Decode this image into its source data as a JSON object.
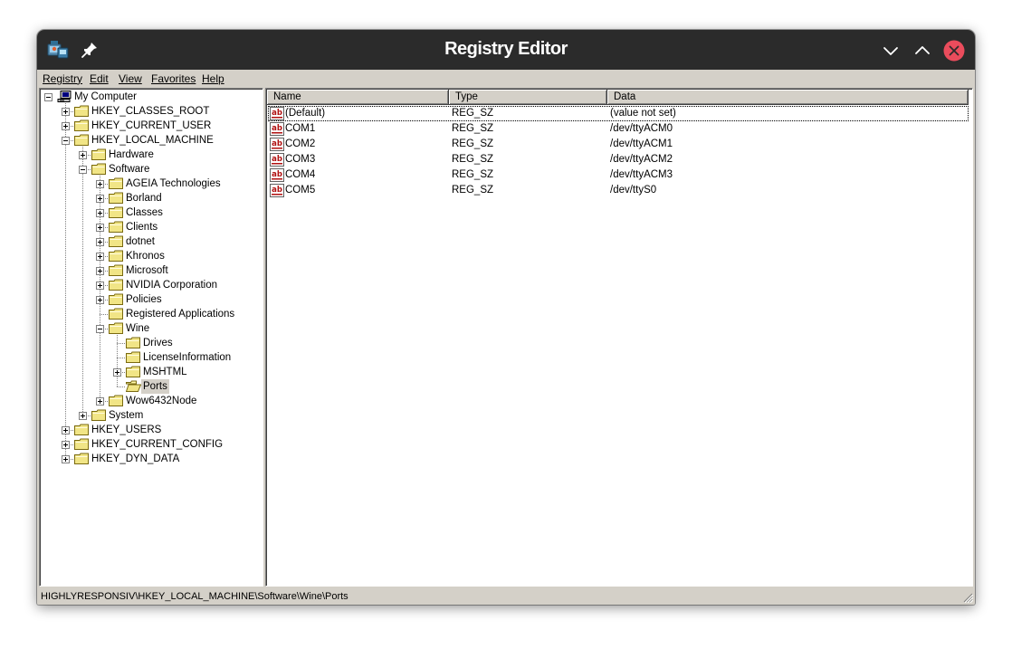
{
  "window": {
    "title": "Registry Editor"
  },
  "titlebar_icons": {
    "app": "registry-app-icon",
    "pin": "pin-icon",
    "minimize": "chevron-down-icon",
    "maximize": "chevron-up-icon",
    "close": "close-icon"
  },
  "menu": [
    "Registry",
    "Edit",
    "View",
    "Favorites",
    "Help"
  ],
  "tree": [
    {
      "label": "My Computer",
      "level": 0,
      "expander": "minus",
      "icon": "computer"
    },
    {
      "label": "HKEY_CLASSES_ROOT",
      "level": 1,
      "expander": "plus",
      "icon": "folder"
    },
    {
      "label": "HKEY_CURRENT_USER",
      "level": 1,
      "expander": "plus",
      "icon": "folder"
    },
    {
      "label": "HKEY_LOCAL_MACHINE",
      "level": 1,
      "expander": "minus",
      "icon": "folder"
    },
    {
      "label": "Hardware",
      "level": 2,
      "expander": "plus",
      "icon": "folder"
    },
    {
      "label": "Software",
      "level": 2,
      "expander": "minus",
      "icon": "folder"
    },
    {
      "label": "AGEIA Technologies",
      "level": 3,
      "expander": "plus",
      "icon": "folder"
    },
    {
      "label": "Borland",
      "level": 3,
      "expander": "plus",
      "icon": "folder"
    },
    {
      "label": "Classes",
      "level": 3,
      "expander": "plus",
      "icon": "folder"
    },
    {
      "label": "Clients",
      "level": 3,
      "expander": "plus",
      "icon": "folder"
    },
    {
      "label": "dotnet",
      "level": 3,
      "expander": "plus",
      "icon": "folder"
    },
    {
      "label": "Khronos",
      "level": 3,
      "expander": "plus",
      "icon": "folder"
    },
    {
      "label": "Microsoft",
      "level": 3,
      "expander": "plus",
      "icon": "folder"
    },
    {
      "label": "NVIDIA Corporation",
      "level": 3,
      "expander": "plus",
      "icon": "folder"
    },
    {
      "label": "Policies",
      "level": 3,
      "expander": "plus",
      "icon": "folder"
    },
    {
      "label": "Registered Applications",
      "level": 3,
      "expander": "none",
      "icon": "folder"
    },
    {
      "label": "Wine",
      "level": 3,
      "expander": "minus",
      "icon": "folder"
    },
    {
      "label": "Drives",
      "level": 4,
      "expander": "none",
      "icon": "folder"
    },
    {
      "label": "LicenseInformation",
      "level": 4,
      "expander": "none",
      "icon": "folder"
    },
    {
      "label": "MSHTML",
      "level": 4,
      "expander": "plus",
      "icon": "folder"
    },
    {
      "label": "Ports",
      "level": 4,
      "expander": "none",
      "icon": "folder-open",
      "selected": true
    },
    {
      "label": "Wow6432Node",
      "level": 3,
      "expander": "plus",
      "icon": "folder"
    },
    {
      "label": "System",
      "level": 2,
      "expander": "plus",
      "icon": "folder"
    },
    {
      "label": "HKEY_USERS",
      "level": 1,
      "expander": "plus",
      "icon": "folder"
    },
    {
      "label": "HKEY_CURRENT_CONFIG",
      "level": 1,
      "expander": "plus",
      "icon": "folder"
    },
    {
      "label": "HKEY_DYN_DATA",
      "level": 1,
      "expander": "plus",
      "icon": "folder"
    }
  ],
  "columns": [
    "Name",
    "Type",
    "Data"
  ],
  "values": [
    {
      "name": "(Default)",
      "type": "REG_SZ",
      "data": "(value not set)",
      "focused": true
    },
    {
      "name": "COM1",
      "type": "REG_SZ",
      "data": "/dev/ttyACM0"
    },
    {
      "name": "COM2",
      "type": "REG_SZ",
      "data": "/dev/ttyACM1"
    },
    {
      "name": "COM3",
      "type": "REG_SZ",
      "data": "/dev/ttyACM2"
    },
    {
      "name": "COM4",
      "type": "REG_SZ",
      "data": "/dev/ttyACM3"
    },
    {
      "name": "COM5",
      "type": "REG_SZ",
      "data": "/dev/ttyS0"
    }
  ],
  "status": {
    "path": "HIGHLYRESPONSIV\\HKEY_LOCAL_MACHINE\\Software\\Wine\\Ports"
  }
}
